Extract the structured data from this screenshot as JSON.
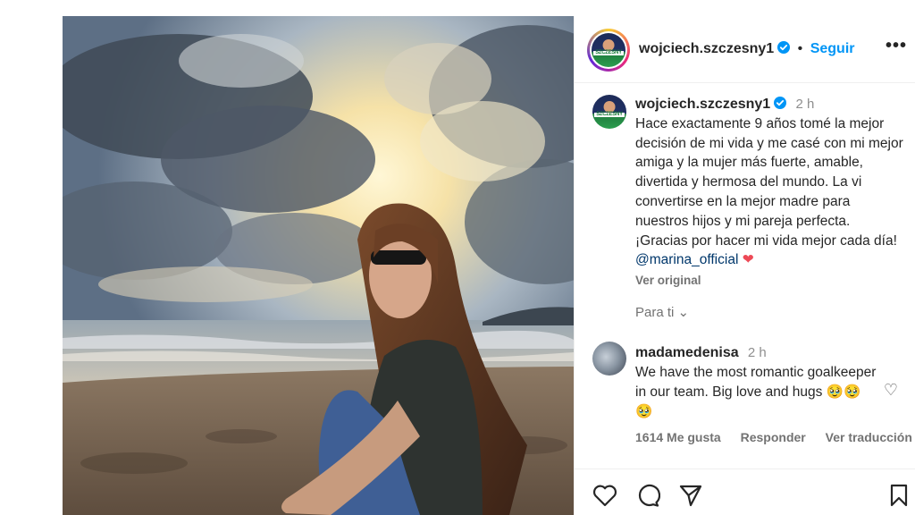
{
  "post": {
    "image_alt": "Woman with sunglasses sitting on a beach at sunset",
    "next_glyph": "›"
  },
  "header": {
    "username": "wojciech.szczesny1",
    "separator": "•",
    "follow_label": "Seguir",
    "more_glyph": "•••",
    "avatar_text": "SZCZESNY"
  },
  "caption": {
    "username": "wojciech.szczesny1",
    "time": "2 h",
    "text": "Hace exactamente 9 años tomé la mejor decisión de mi vida y me casé con mi mejor amiga y la mujer más fuerte, amable, divertida y hermosa del mundo. La vi convertirse en la mejor madre para nuestros hijos y mi pareja perfecta. ¡Gracias por hacer mi vida mejor cada día!",
    "mention": "@marina_official",
    "heart": "❤",
    "see_original": "Ver original"
  },
  "for_you": {
    "label": "Para ti",
    "chevron": "⌄"
  },
  "comment": {
    "username": "madamedenisa",
    "time": "2 h",
    "text": "We have the most romantic goalkeeper in our team. Big love and hugs 🥹🥹🥹",
    "likes": "1614 Me gusta",
    "reply": "Responder",
    "translate": "Ver traducción",
    "like_icon": "♡"
  },
  "actions": {
    "icons": [
      "heart-icon",
      "comment-icon",
      "share-icon",
      "bookmark-icon"
    ]
  },
  "colors": {
    "accent": "#0095f6",
    "text": "#262626",
    "muted": "#737373",
    "mention": "#00376b",
    "heart": "#ed4956"
  }
}
